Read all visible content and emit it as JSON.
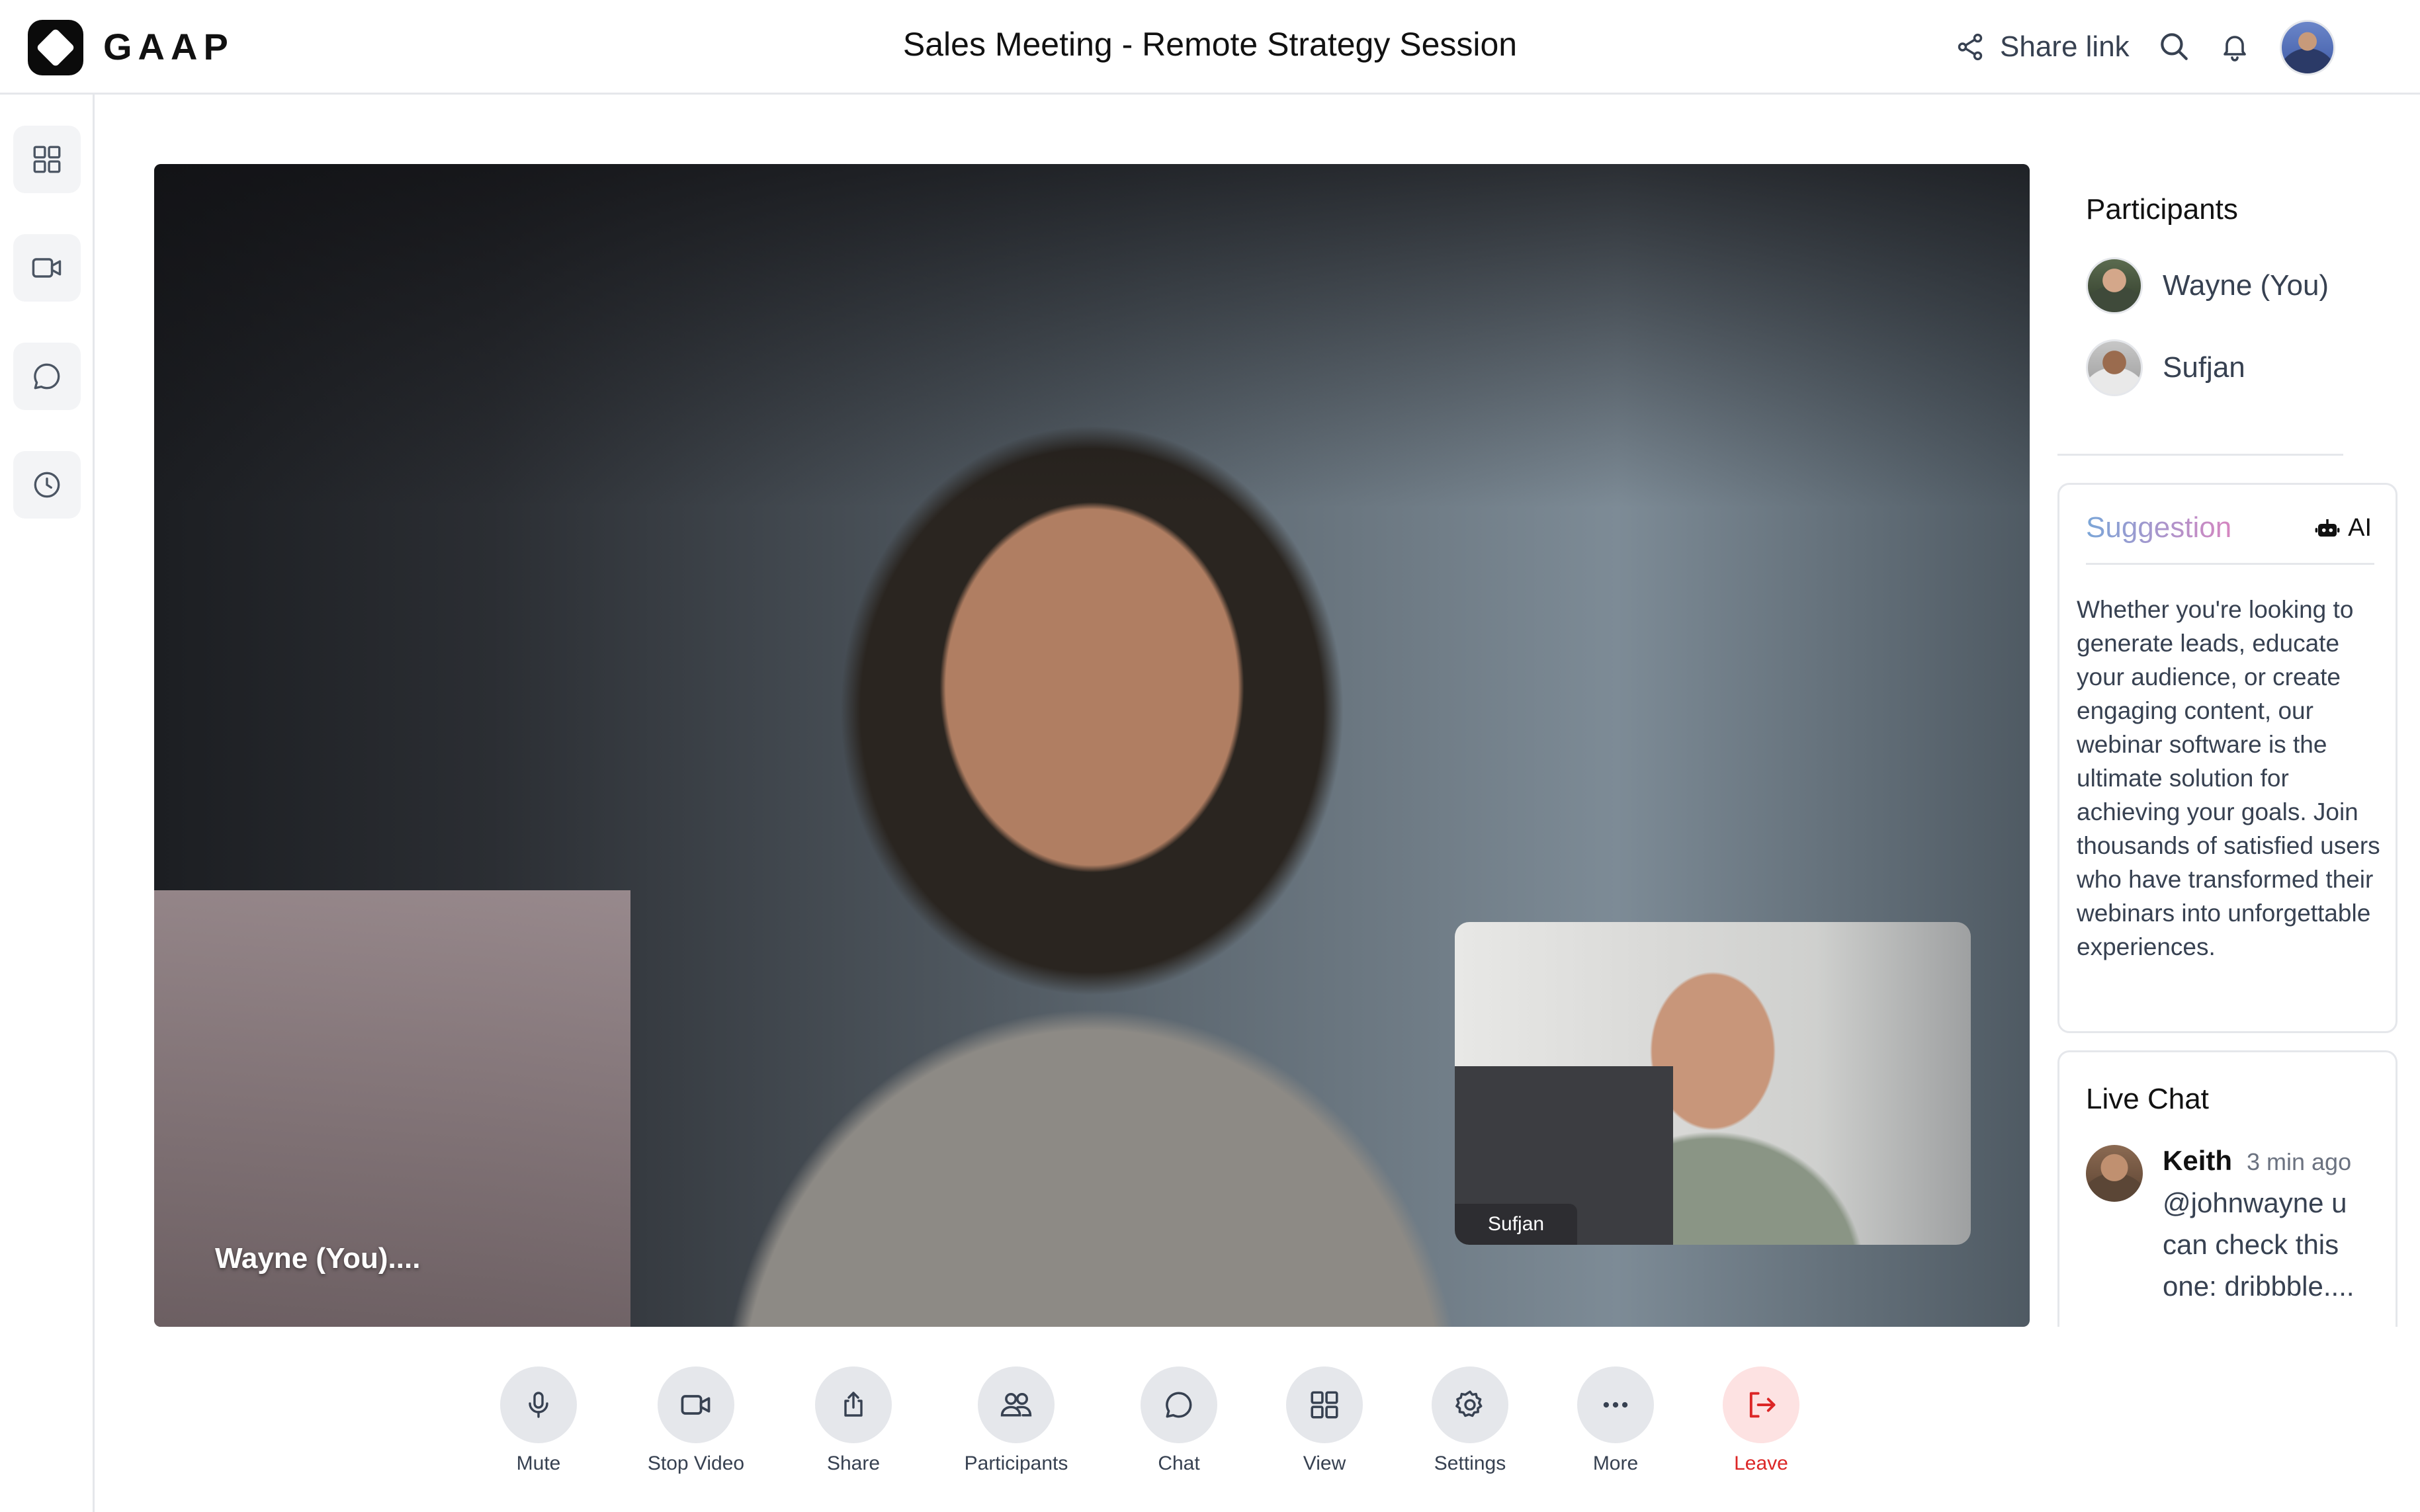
{
  "header": {
    "brand": "GAAP",
    "meeting_title": "Sales Meeting - Remote Strategy Session",
    "share_link_label": "Share link"
  },
  "sidebar": {
    "items": [
      {
        "icon": "grid-icon"
      },
      {
        "icon": "video-icon"
      },
      {
        "icon": "chat-bubble-icon"
      },
      {
        "icon": "clock-icon"
      }
    ]
  },
  "stage": {
    "speaker_label": "Wayne (You)....",
    "pip_label": "Sufjan"
  },
  "participants": {
    "title": "Participants",
    "list": [
      {
        "name": "Wayne (You)"
      },
      {
        "name": "Sufjan"
      }
    ]
  },
  "suggestion": {
    "title": "Suggestion",
    "ai_label": "AI",
    "body": "Whether you're looking to generate leads, educate your audience, or create engaging content, our webinar software is the ultimate solution for achieving your goals. Join thousands of satisfied users who have transformed their webinars into unforgettable experiences."
  },
  "live_chat": {
    "title": "Live Chat",
    "messages": [
      {
        "author": "Keith",
        "time": "3 min ago",
        "text": "@johnwayne u can check this one: dribbble...."
      }
    ]
  },
  "controls": [
    {
      "label": "Mute",
      "icon": "microphone-icon"
    },
    {
      "label": "Stop Video",
      "icon": "video-camera-icon"
    },
    {
      "label": "Share",
      "icon": "share-upload-icon"
    },
    {
      "label": "Participants",
      "icon": "people-icon"
    },
    {
      "label": "Chat",
      "icon": "chat-icon"
    },
    {
      "label": "View",
      "icon": "grid-view-icon"
    },
    {
      "label": "Settings",
      "icon": "gear-icon"
    },
    {
      "label": "More",
      "icon": "more-dots-icon"
    },
    {
      "label": "Leave",
      "icon": "leave-icon"
    }
  ],
  "colors": {
    "leave": "#dc2626",
    "suggestion_gradient_start": "#7aa6d8",
    "suggestion_gradient_end": "#d685c0"
  }
}
